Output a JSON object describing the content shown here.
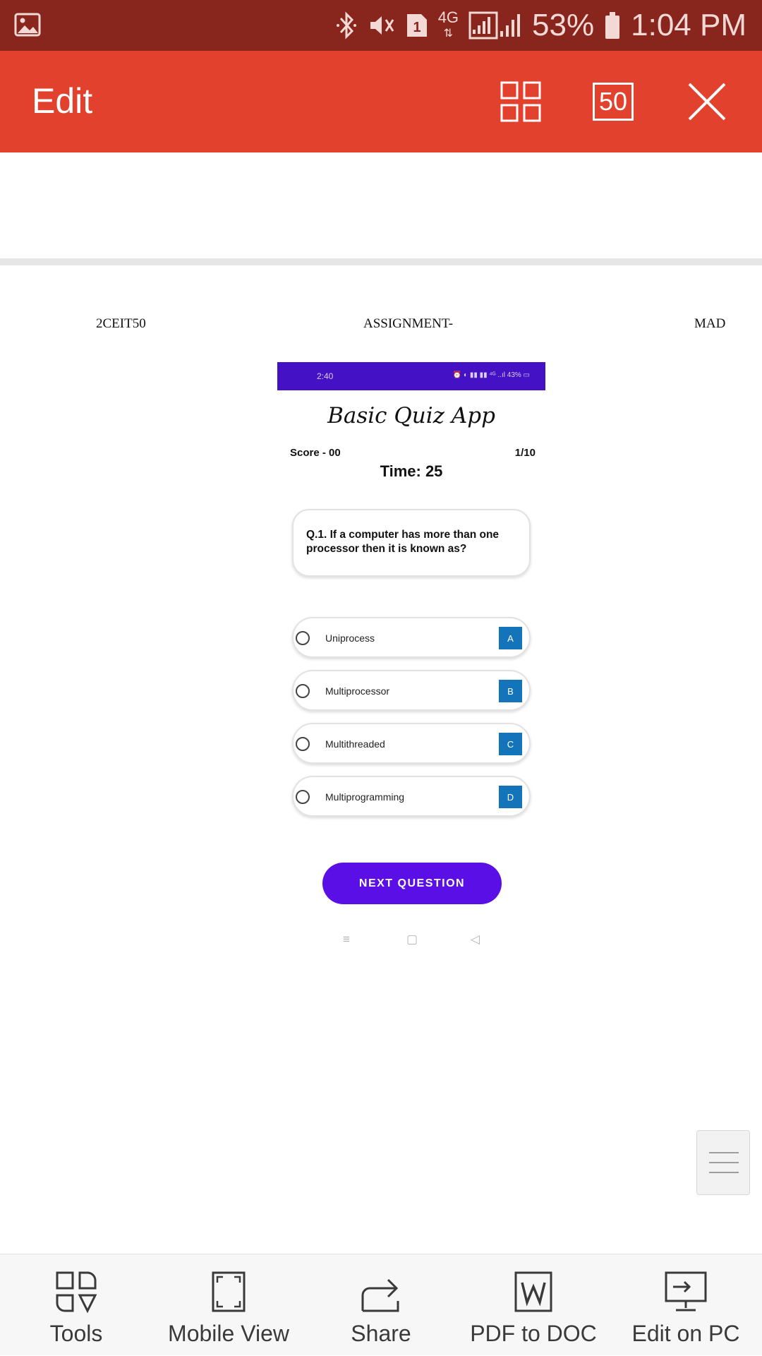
{
  "status_bar": {
    "battery_percent": "53%",
    "time": "1:04 PM",
    "network": "4G",
    "sim_badge": "1",
    "icons": [
      "gallery-icon",
      "bluetooth-icon",
      "mute-icon",
      "sim-icon",
      "signal-icon",
      "battery-icon"
    ]
  },
  "app_bar": {
    "title": "Edit",
    "page_number": "50",
    "icons": [
      "pages-grid-icon",
      "page-number-box",
      "close-icon"
    ]
  },
  "document": {
    "header_left": "2CEIT50",
    "header_center": "ASSIGNMENT-",
    "header_right": "MAD"
  },
  "embedded_screenshot": {
    "status_time": "2:40",
    "status_icons": "⏰ ◐ ▮▮ ▮▮ ⁴ᴳ ..ıl 43% ▭",
    "title": "Basic Quiz App",
    "score": "Score - 00",
    "progress": "1/10",
    "timer": "Time: 25",
    "question": "Q.1. If a computer has more than one processor then it is known as?",
    "options": [
      {
        "label": "Uniprocess",
        "key": "A"
      },
      {
        "label": "Multiprocessor",
        "key": "B"
      },
      {
        "label": "Multithreaded",
        "key": "C"
      },
      {
        "label": "Multiprogramming",
        "key": "D"
      }
    ],
    "next_button": "NEXT QUESTION",
    "nav": {
      "menu": "≡",
      "home": "▢",
      "back": "◁"
    }
  },
  "bottom_toolbar": {
    "items": [
      {
        "label": "Tools",
        "icon": "tools-icon"
      },
      {
        "label": "Mobile View",
        "icon": "mobile-view-icon"
      },
      {
        "label": "Share",
        "icon": "share-icon"
      },
      {
        "label": "PDF to DOC",
        "icon": "pdf-to-doc-icon"
      },
      {
        "label": "Edit on PC",
        "icon": "edit-on-pc-icon"
      }
    ]
  },
  "colors": {
    "status_bar": "#88251c",
    "app_bar": "#e1412d",
    "quiz_status": "#4411c4",
    "option_key": "#1374ba",
    "next_button": "#5a0fe6"
  }
}
